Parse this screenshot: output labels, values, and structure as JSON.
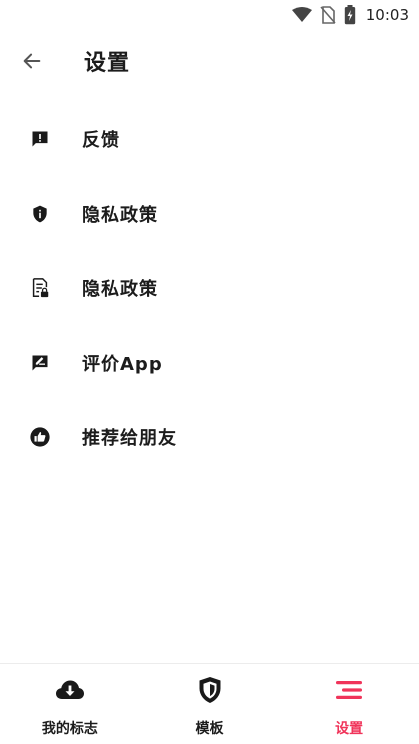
{
  "status_bar": {
    "time": "10:03",
    "icons": [
      "wifi-icon",
      "no-sim-icon",
      "battery-charging-icon"
    ]
  },
  "header": {
    "title": "设置",
    "back_icon": "arrow-back-icon"
  },
  "menu": {
    "items": [
      {
        "label": "反馈",
        "icon": "feedback-icon"
      },
      {
        "label": "隐私政策",
        "icon": "shield-info-icon"
      },
      {
        "label": "隐私政策",
        "icon": "document-lock-icon"
      },
      {
        "label": "评价App",
        "icon": "rate-review-icon"
      },
      {
        "label": "推荐给朋友",
        "icon": "thumb-up-icon"
      }
    ]
  },
  "bottom_nav": {
    "items": [
      {
        "label": "我的标志",
        "icon": "cloud-download-icon",
        "active": false
      },
      {
        "label": "模板",
        "icon": "shield-icon",
        "active": false
      },
      {
        "label": "设置",
        "icon": "menu-lines-icon",
        "active": true
      }
    ],
    "active_color": "#f0345a"
  }
}
